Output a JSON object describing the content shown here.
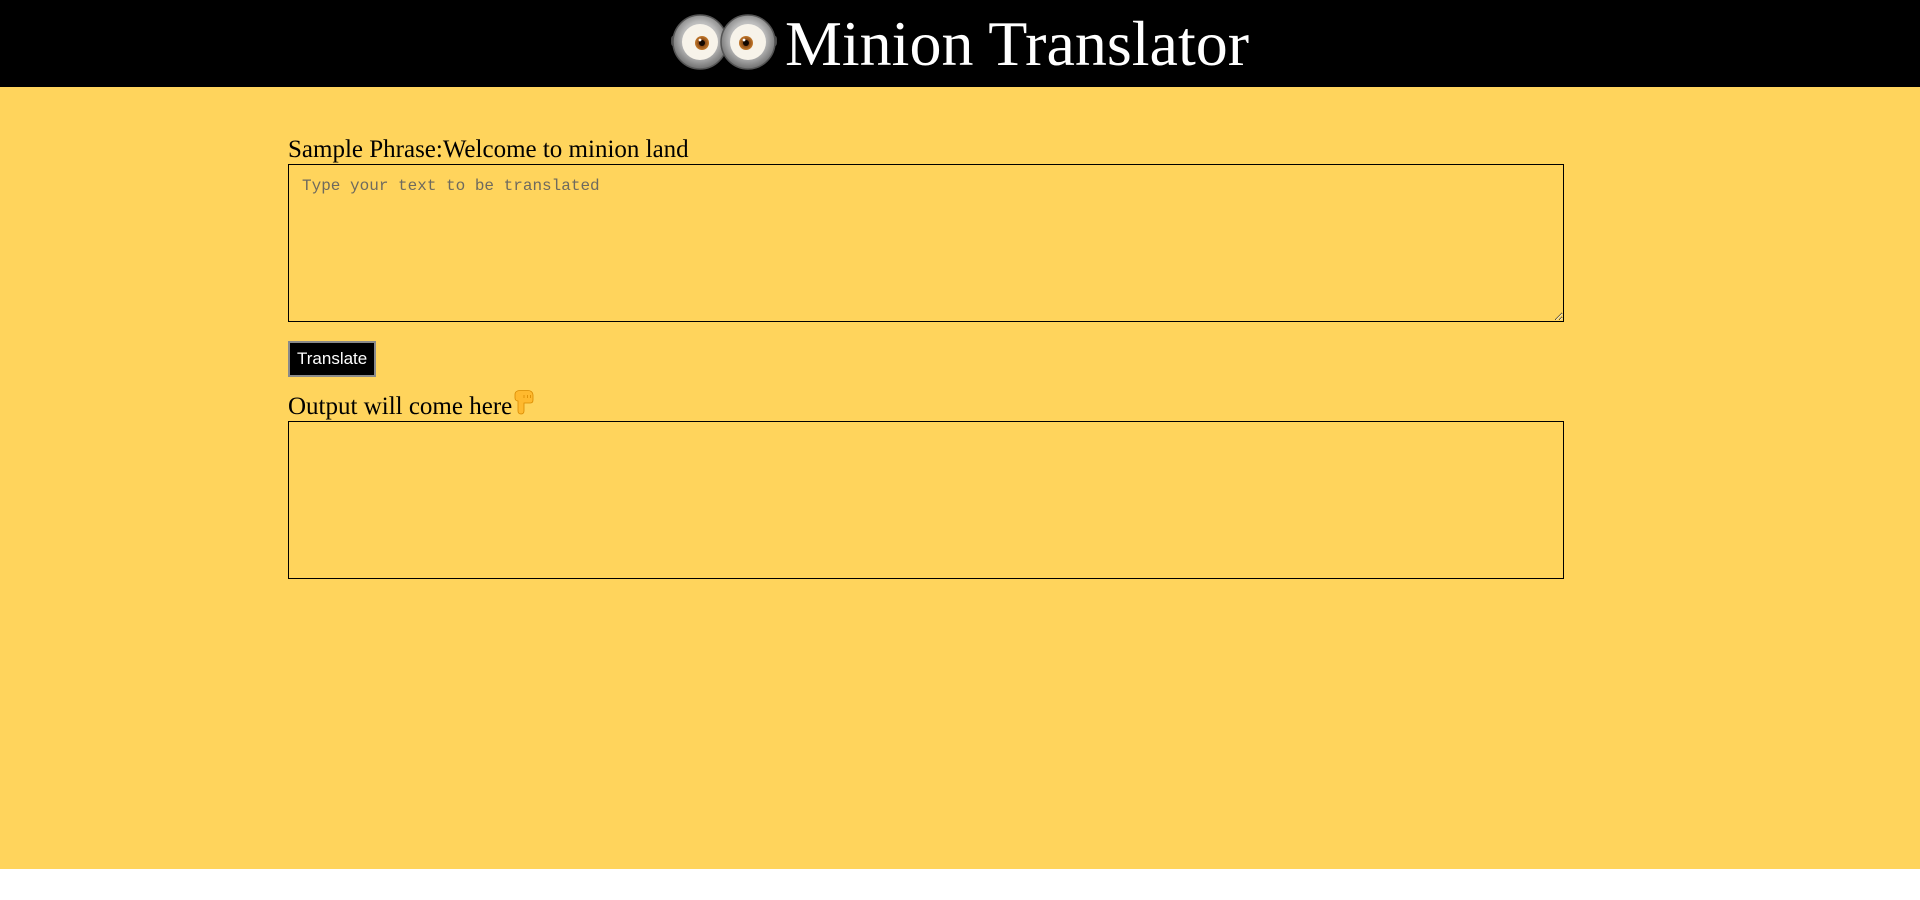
{
  "header": {
    "title": "Minion Translator",
    "logo_icon": "minion-goggles-icon"
  },
  "input_section": {
    "sample_label": "Sample Phrase:Welcome to minion land",
    "placeholder": "Type your text to be translated",
    "value": ""
  },
  "translate_button": {
    "label": "Translate"
  },
  "output_section": {
    "label": "Output will come here",
    "pointer_icon": "pointing-down-hand-icon",
    "text": ""
  },
  "colors": {
    "background": "#ffd45c",
    "header": "#000000",
    "title_text": "#ffffff",
    "button_bg": "#000000",
    "button_text": "#ffffff"
  }
}
